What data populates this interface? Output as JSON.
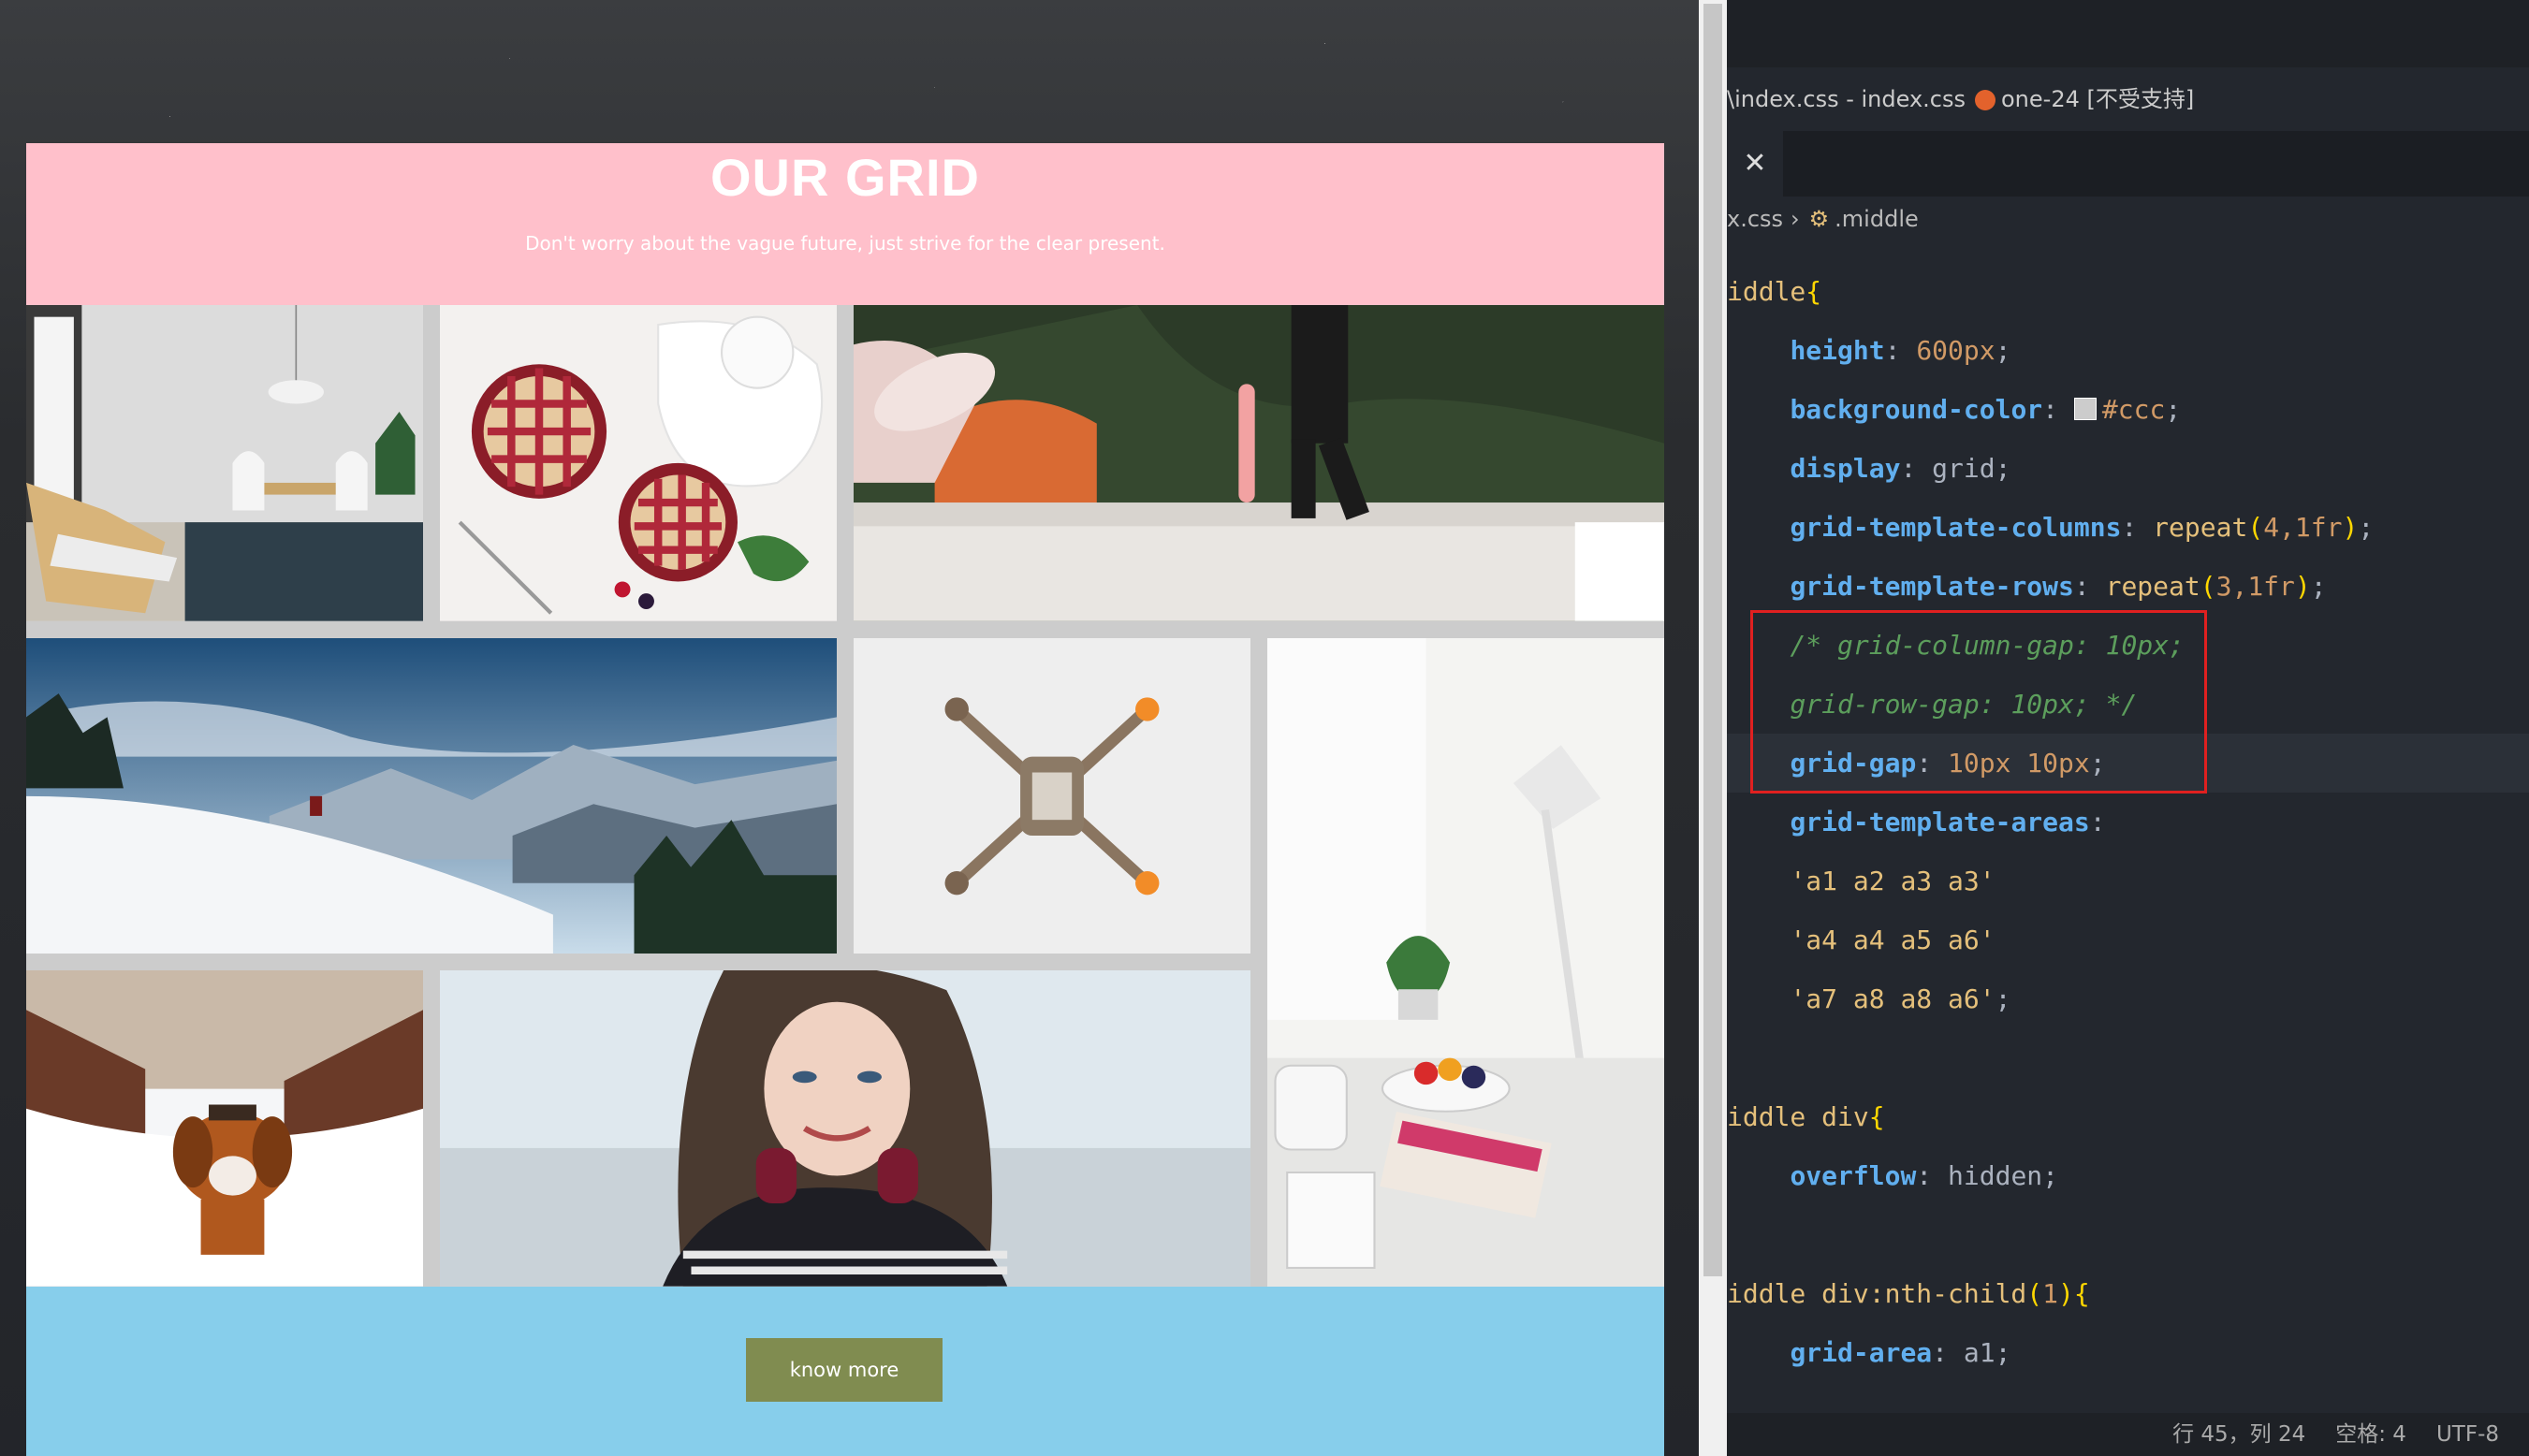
{
  "page": {
    "title": "OUR GRID",
    "subtitle": "Don't worry about the vague future, just strive for the clear present.",
    "button_label": "know more",
    "colors": {
      "header_bg": "#ffc0cb",
      "grid_bg": "#cccccc",
      "footer_bg": "#87ceeb",
      "button_bg": "#808c50"
    },
    "grid_items": [
      {
        "area": "a1",
        "image": "scandinavian-dining-room-photo"
      },
      {
        "area": "a2",
        "image": "berry-pies-photo"
      },
      {
        "area": "a3",
        "image": "skateboarder-rooftop-photo"
      },
      {
        "area": "a4",
        "image": "snowy-mountains-photo"
      },
      {
        "area": "a5",
        "image": "drone-top-view-photo"
      },
      {
        "area": "a6",
        "image": "desk-lamp-workspace-photo"
      },
      {
        "area": "a7",
        "image": "puppy-in-snow-photo"
      },
      {
        "area": "a8",
        "image": "smiling-woman-portrait-photo"
      }
    ]
  },
  "editor": {
    "title": "\\index.css - index.css",
    "project": "one-24 [不受支持]",
    "close_glyph": "✕",
    "breadcrumb_file": "x.css",
    "breadcrumb_symbol": ".middle",
    "code": {
      "l1_sel": "iddle",
      "l1_brace": "{",
      "height_prop": "height",
      "height_val": "600px",
      "bg_prop": "background-color",
      "bg_val": "#ccc",
      "display_prop": "display",
      "display_val": "grid",
      "gtc_prop": "grid-template-columns",
      "gtc_fn": "repeat",
      "gtc_args": "4,1fr",
      "gtr_prop": "grid-template-rows",
      "gtr_fn": "repeat",
      "gtr_args": "3,1fr",
      "comment1": "/* grid-column-gap: 10px;",
      "comment2": "grid-row-gap: 10px; */",
      "gap_prop": "grid-gap",
      "gap_val": "10px 10px",
      "areas_prop": "grid-template-areas",
      "area1": "'a1 a2 a3 a3'",
      "area2": "'a4 a4 a5 a6'",
      "area3": "'a7 a8 a8 a6'",
      "sel2": "iddle div",
      "overflow_prop": "overflow",
      "overflow_val": "hidden",
      "sel3": "iddle div:nth-child",
      "sel3_arg": "1",
      "ga_prop": "grid-area",
      "ga_val": "a1"
    },
    "status": {
      "position": "行 45，列 24",
      "indent": "空格: 4",
      "encoding": "UTF-8"
    }
  }
}
